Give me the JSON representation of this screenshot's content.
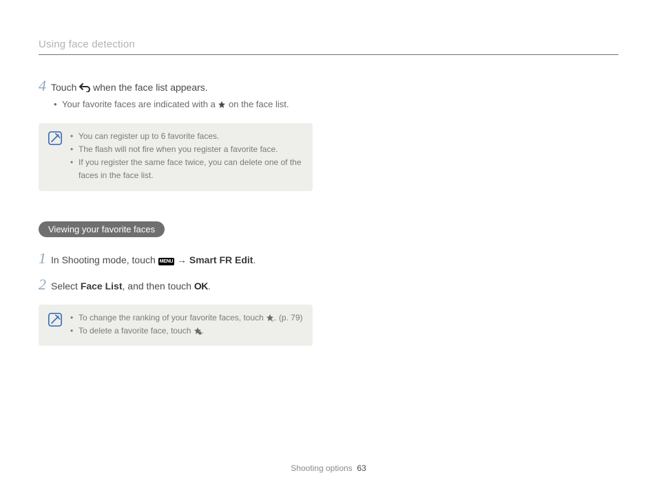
{
  "header": "Using face detection",
  "step4": {
    "num": "4",
    "text_before": "Touch ",
    "text_after": " when the face list appears.",
    "bullet_before": "Your favorite faces are indicated with a ",
    "bullet_after": " on the face list."
  },
  "note1": {
    "items": [
      "You can register up to 6 favorite faces.",
      "The flash will not fire when you register a favorite face.",
      "If you register the same face twice, you can delete one of the faces in the face list."
    ]
  },
  "pill": "Viewing your favorite faces",
  "step1": {
    "num": "1",
    "text_before": "In Shooting mode, touch ",
    "arrow": " → ",
    "bold": "Smart FR Edit",
    "period": "."
  },
  "step2": {
    "num": "2",
    "text_before": "Select ",
    "bold": "Face List",
    "text_mid": ", and then touch ",
    "ok": "OK",
    "period": "."
  },
  "note2": {
    "item1_before": "To change the ranking of your favorite faces, touch ",
    "item1_after": ". (p. 79)",
    "item2_before": "To delete a favorite face, touch ",
    "item2_after": "."
  },
  "footer": {
    "section": "Shooting options",
    "page": "63"
  }
}
